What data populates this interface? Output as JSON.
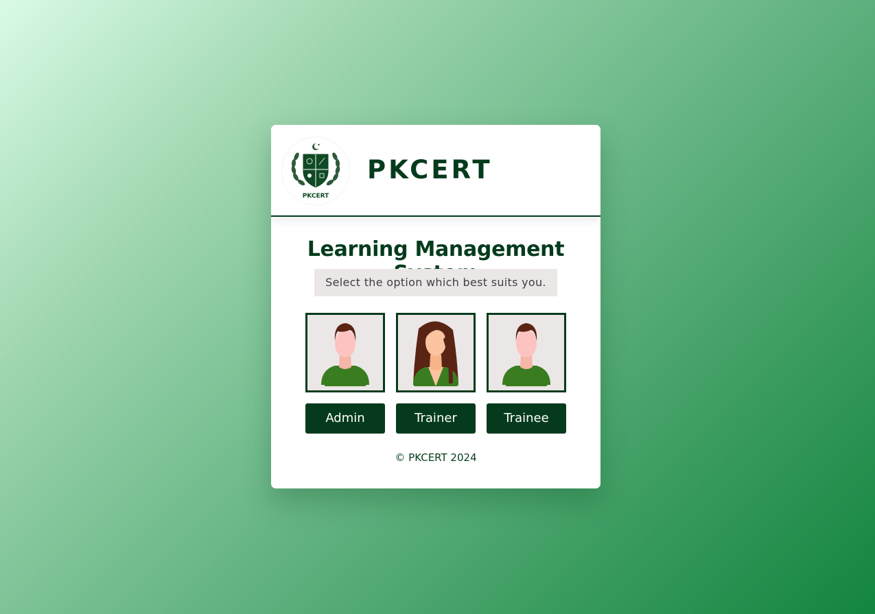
{
  "brand": {
    "name": "PKCERT",
    "logo_caption": "PKCERT",
    "logo_icon": "pkcert-crest-icon"
  },
  "main": {
    "title": "Learning Management System",
    "subtitle": "Select the option which best suits you."
  },
  "roles": [
    {
      "label": "Admin",
      "avatar": "male-avatar-icon"
    },
    {
      "label": "Trainer",
      "avatar": "female-avatar-icon"
    },
    {
      "label": "Trainee",
      "avatar": "male-avatar-icon"
    }
  ],
  "footer": {
    "text": "© PKCERT 2024"
  },
  "colors": {
    "primary": "#053b1c",
    "subtitle_bg": "#ebe7e6",
    "avatar_shirt": "#3a7d20",
    "background_start": "#d9fbe6",
    "background_end": "#138540"
  }
}
